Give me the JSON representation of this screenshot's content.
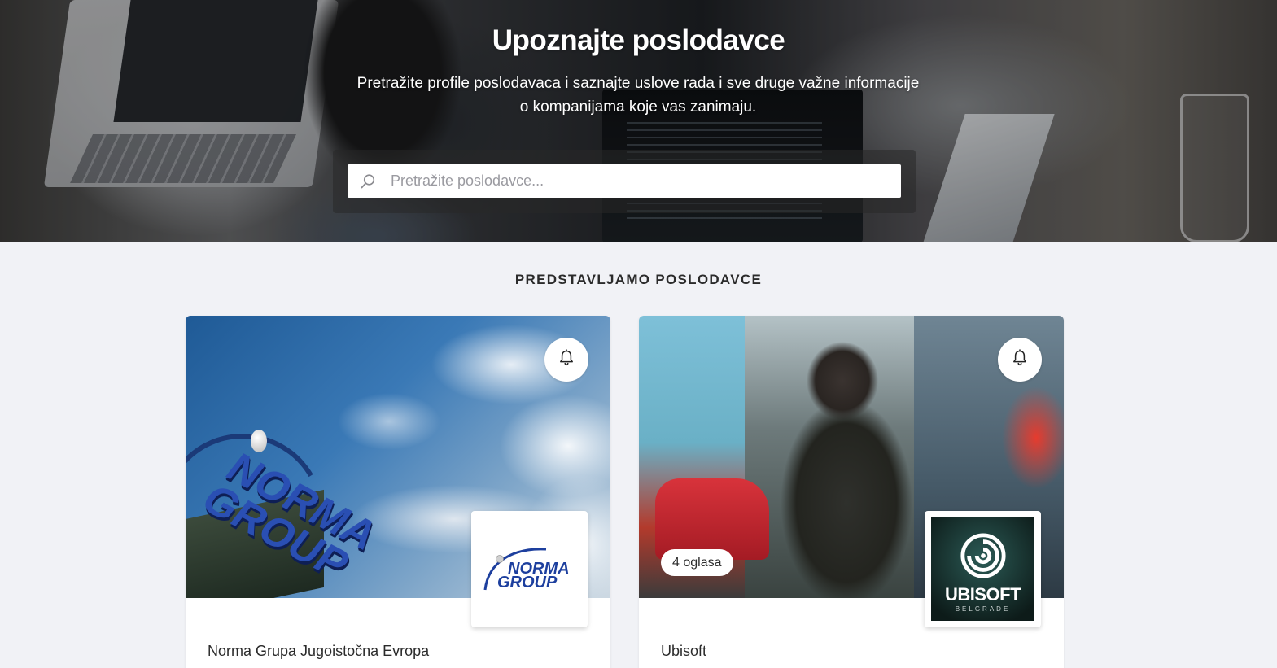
{
  "hero": {
    "title": "Upoznajte poslodavce",
    "subtitle": "Pretražite profile poslodavaca i saznajte uslove rada i sve druge važne informacije o kompanijama koje vas zanimaju."
  },
  "search": {
    "placeholder": "Pretražite poslodavce...",
    "value": "",
    "icon": "search-icon"
  },
  "featured": {
    "title": "PREDSTAVLJAMO POSLODAVCE",
    "cards": [
      {
        "name": "Norma Grupa Jugoistočna Evropa",
        "logo_text": "NORMA GROUP",
        "jobs_badge": "",
        "icon": "bell-icon"
      },
      {
        "name": "Ubisoft",
        "logo_text": "UBISOFT",
        "logo_subtext": "BELGRADE",
        "jobs_badge": "4 oglasa",
        "icon": "bell-icon"
      }
    ]
  },
  "colors": {
    "page_bg": "#f1f2f6",
    "card_bg": "#ffffff",
    "norma_blue": "#1d3f9e",
    "text": "#2b2b2b"
  }
}
